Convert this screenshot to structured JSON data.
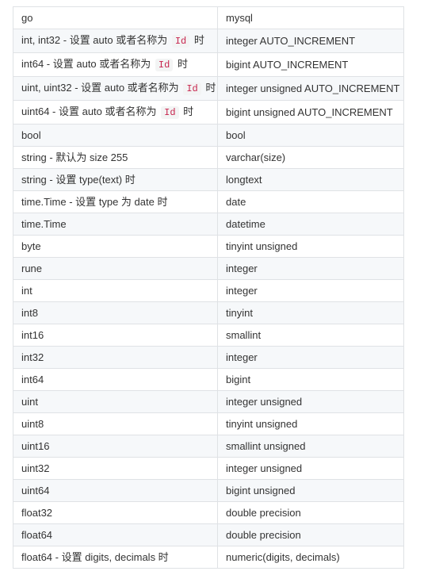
{
  "table": {
    "rows": [
      {
        "go": {
          "pre": "go"
        },
        "mysql": "mysql"
      },
      {
        "go": {
          "pre": "int, int32 - 设置 auto 或者名称为",
          "code": "Id",
          "post": "时"
        },
        "mysql": "integer AUTO_INCREMENT"
      },
      {
        "go": {
          "pre": "int64 - 设置 auto 或者名称为",
          "code": "Id",
          "post": "时"
        },
        "mysql": "bigint AUTO_INCREMENT"
      },
      {
        "go": {
          "pre": "uint, uint32 - 设置 auto 或者名称为",
          "code": "Id",
          "post": "时"
        },
        "mysql": "integer unsigned AUTO_INCREMENT"
      },
      {
        "go": {
          "pre": "uint64 - 设置 auto 或者名称为",
          "code": "Id",
          "post": "时"
        },
        "mysql": "bigint unsigned AUTO_INCREMENT"
      },
      {
        "go": {
          "pre": "bool"
        },
        "mysql": "bool"
      },
      {
        "go": {
          "pre": "string - 默认为 size 255"
        },
        "mysql": "varchar(size)"
      },
      {
        "go": {
          "pre": "string - 设置 type(text) 时"
        },
        "mysql": "longtext"
      },
      {
        "go": {
          "pre": "time.Time - 设置 type 为 date 时"
        },
        "mysql": "date"
      },
      {
        "go": {
          "pre": "time.Time"
        },
        "mysql": "datetime"
      },
      {
        "go": {
          "pre": "byte"
        },
        "mysql": "tinyint unsigned"
      },
      {
        "go": {
          "pre": "rune"
        },
        "mysql": "integer"
      },
      {
        "go": {
          "pre": "int"
        },
        "mysql": "integer"
      },
      {
        "go": {
          "pre": "int8"
        },
        "mysql": "tinyint"
      },
      {
        "go": {
          "pre": "int16"
        },
        "mysql": "smallint"
      },
      {
        "go": {
          "pre": "int32"
        },
        "mysql": "integer"
      },
      {
        "go": {
          "pre": "int64"
        },
        "mysql": "bigint"
      },
      {
        "go": {
          "pre": "uint"
        },
        "mysql": "integer unsigned"
      },
      {
        "go": {
          "pre": "uint8"
        },
        "mysql": "tinyint unsigned"
      },
      {
        "go": {
          "pre": "uint16"
        },
        "mysql": "smallint unsigned"
      },
      {
        "go": {
          "pre": "uint32"
        },
        "mysql": "integer unsigned"
      },
      {
        "go": {
          "pre": "uint64"
        },
        "mysql": "bigint unsigned"
      },
      {
        "go": {
          "pre": "float32"
        },
        "mysql": "double precision"
      },
      {
        "go": {
          "pre": "float64"
        },
        "mysql": "double precision"
      },
      {
        "go": {
          "pre": "float64 - 设置 digits, decimals 时"
        },
        "mysql": "numeric(digits, decimals)"
      }
    ]
  },
  "colors": {
    "border": "#dfe2e5",
    "row_alt": "#f6f8fa",
    "code_text": "#c7254e"
  }
}
